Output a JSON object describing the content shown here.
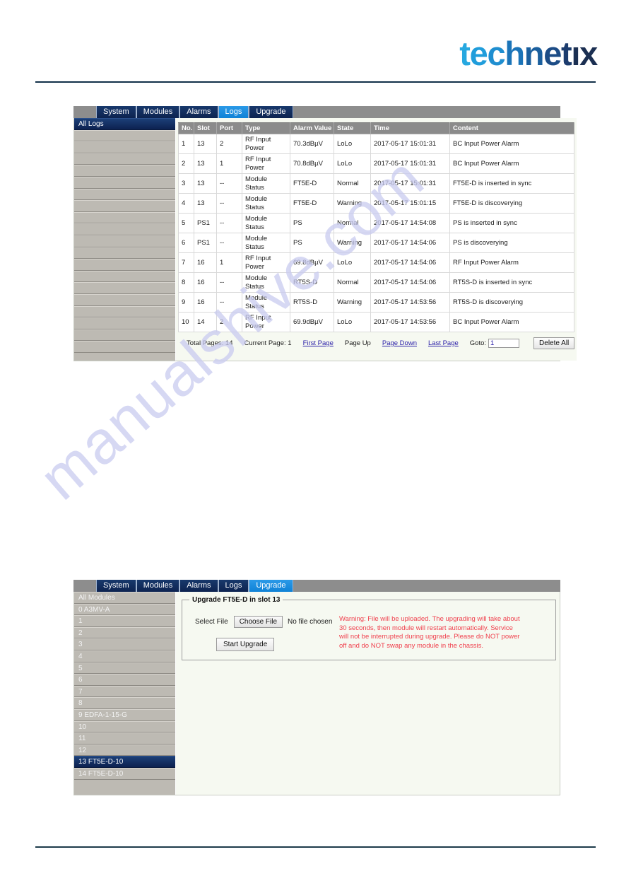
{
  "brand": {
    "logo_text": "technetix",
    "logo_letters": [
      "t",
      "e",
      "c",
      "h",
      "n",
      "e",
      "t",
      "ı",
      "x"
    ],
    "accent_light": "#27a8e0",
    "accent_dark": "#1b2f52"
  },
  "watermark": {
    "text": "manualshive.com",
    "color": "#c9cbf0"
  },
  "panel_logs": {
    "tabs": [
      {
        "label": "System",
        "active": false
      },
      {
        "label": "Modules",
        "active": false
      },
      {
        "label": "Alarms",
        "active": false
      },
      {
        "label": "Logs",
        "active": true
      },
      {
        "label": "Upgrade",
        "active": false
      }
    ],
    "sidebar": {
      "items": [
        {
          "label": "All Logs",
          "selected": true
        },
        {
          "label": "",
          "selected": false
        },
        {
          "label": "",
          "selected": false
        },
        {
          "label": "",
          "selected": false
        },
        {
          "label": "",
          "selected": false
        },
        {
          "label": "",
          "selected": false
        },
        {
          "label": "",
          "selected": false
        },
        {
          "label": "",
          "selected": false
        },
        {
          "label": "",
          "selected": false
        },
        {
          "label": "",
          "selected": false
        },
        {
          "label": "",
          "selected": false
        },
        {
          "label": "",
          "selected": false
        },
        {
          "label": "",
          "selected": false
        },
        {
          "label": "",
          "selected": false
        },
        {
          "label": "",
          "selected": false
        },
        {
          "label": "",
          "selected": false
        },
        {
          "label": "",
          "selected": false
        },
        {
          "label": "",
          "selected": false
        },
        {
          "label": "",
          "selected": false
        },
        {
          "label": "",
          "selected": false
        }
      ]
    },
    "table": {
      "headers": [
        "No.",
        "Slot",
        "Port",
        "Type",
        "Alarm Value",
        "State",
        "Time",
        "Content"
      ],
      "rows": [
        {
          "no": "1",
          "slot": "13",
          "port": "2",
          "type": "RF Input Power",
          "alarm_value": "70.3dBµV",
          "state": "LoLo",
          "time": "2017-05-17 15:01:31",
          "content": "BC Input Power Alarm",
          "tall": true
        },
        {
          "no": "2",
          "slot": "13",
          "port": "1",
          "type": "RF Input Power",
          "alarm_value": "70.8dBµV",
          "state": "LoLo",
          "time": "2017-05-17 15:01:31",
          "content": "BC Input Power Alarm",
          "tall": true
        },
        {
          "no": "3",
          "slot": "13",
          "port": "--",
          "type": "Module Status",
          "alarm_value": "FT5E-D",
          "state": "Normal",
          "time": "2017-05-17 15:01:31",
          "content": "FT5E-D is inserted in sync",
          "tall": false
        },
        {
          "no": "4",
          "slot": "13",
          "port": "--",
          "type": "Module Status",
          "alarm_value": "FT5E-D",
          "state": "Warning",
          "time": "2017-05-17 15:01:15",
          "content": "FT5E-D is discoverying",
          "tall": false
        },
        {
          "no": "5",
          "slot": "PS1",
          "port": "--",
          "type": "Module Status",
          "alarm_value": "PS",
          "state": "Normal",
          "time": "2017-05-17 14:54:08",
          "content": "PS is inserted in sync",
          "tall": false
        },
        {
          "no": "6",
          "slot": "PS1",
          "port": "--",
          "type": "Module Status",
          "alarm_value": "PS",
          "state": "Warning",
          "time": "2017-05-17 14:54:06",
          "content": "PS is discoverying",
          "tall": false
        },
        {
          "no": "7",
          "slot": "16",
          "port": "1",
          "type": "RF Input Power",
          "alarm_value": "69.8dBµV",
          "state": "LoLo",
          "time": "2017-05-17 14:54:06",
          "content": "RF Input Power Alarm",
          "tall": true
        },
        {
          "no": "8",
          "slot": "16",
          "port": "--",
          "type": "Module Status",
          "alarm_value": "RT5S-D",
          "state": "Normal",
          "time": "2017-05-17 14:54:06",
          "content": "RT5S-D is inserted in sync",
          "tall": false
        },
        {
          "no": "9",
          "slot": "16",
          "port": "--",
          "type": "Module Status",
          "alarm_value": "RT5S-D",
          "state": "Warning",
          "time": "2017-05-17 14:53:56",
          "content": "RT5S-D is discoverying",
          "tall": false
        },
        {
          "no": "10",
          "slot": "14",
          "port": "2",
          "type": "RF Input Power",
          "alarm_value": "69.9dBµV",
          "state": "LoLo",
          "time": "2017-05-17 14:53:56",
          "content": "BC Input Power Alarm",
          "tall": true
        }
      ]
    },
    "pager": {
      "total_pages_label": "Total Pages:  14",
      "current_page_label": "Current Page: 1",
      "first_page": "First Page",
      "page_up": "Page Up",
      "page_down": "Page Down",
      "last_page": "Last Page",
      "goto_label": "Goto:",
      "goto_value": "1",
      "delete_all": "Delete All"
    }
  },
  "panel_upgrade": {
    "tabs": [
      {
        "label": "System",
        "active": false
      },
      {
        "label": "Modules",
        "active": false
      },
      {
        "label": "Alarms",
        "active": false
      },
      {
        "label": "Logs",
        "active": false
      },
      {
        "label": "Upgrade",
        "active": true
      }
    ],
    "sidebar": {
      "items": [
        {
          "label": "All Modules",
          "selected": false
        },
        {
          "label": "0 A3MV-A",
          "selected": false
        },
        {
          "label": "1",
          "selected": false
        },
        {
          "label": "2",
          "selected": false
        },
        {
          "label": "3",
          "selected": false
        },
        {
          "label": "4",
          "selected": false
        },
        {
          "label": "5",
          "selected": false
        },
        {
          "label": "6",
          "selected": false
        },
        {
          "label": "7",
          "selected": false
        },
        {
          "label": "8",
          "selected": false
        },
        {
          "label": "9 EDFA-1-15-G",
          "selected": false
        },
        {
          "label": "10",
          "selected": false
        },
        {
          "label": "11",
          "selected": false
        },
        {
          "label": "12",
          "selected": false
        },
        {
          "label": "13 FT5E-D-10",
          "selected": true
        },
        {
          "label": "14 FT5E-D-10",
          "selected": false
        }
      ]
    },
    "form": {
      "legend": "Upgrade FT5E-D in slot 13",
      "select_file_label": "Select File",
      "choose_file_button": "Choose File",
      "file_status": "No file chosen",
      "start_button": "Start Upgrade",
      "warning": "Warning: File will be uploaded. The upgrading will take about 30 seconds, then module will restart automatically. Service will not be interrupted during upgrade. Please do NOT power off and do NOT swap any module in the chassis.",
      "warning_color": "#f0414e"
    }
  }
}
